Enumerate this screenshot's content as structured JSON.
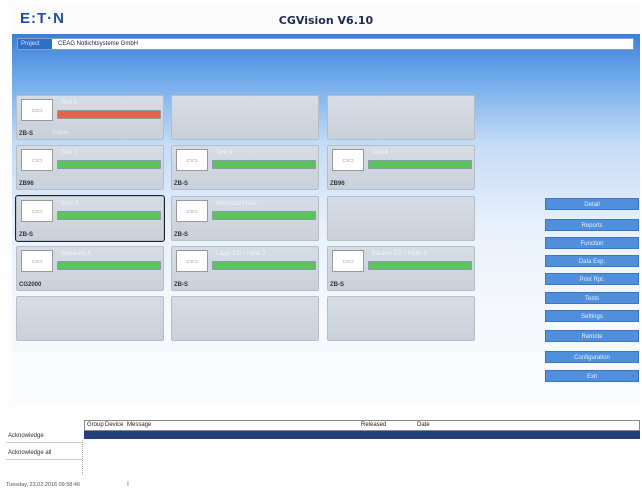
{
  "header": {
    "logo": "E:T·N",
    "title": "CGVision V6.10"
  },
  "project": {
    "label": "Project",
    "value": "CEAG Notlichtsysteme GmbH"
  },
  "colors": {
    "alarm": "#e36548",
    "ok": "#5cc45c",
    "accent": "#4f8fdc",
    "row_selected": "#23407a"
  },
  "tiles": [
    {
      "name": "Test 1",
      "code": "ZB-S",
      "status": "Failure",
      "state": "alarm"
    },
    {
      "name": "",
      "code": "",
      "status": "",
      "state": "empty"
    },
    {
      "name": "",
      "code": "",
      "status": "",
      "state": "empty"
    },
    {
      "name": "Test 2",
      "code": "ZB96",
      "status": "",
      "state": "ok"
    },
    {
      "name": "Test 3",
      "code": "ZB-S",
      "status": "",
      "state": "ok"
    },
    {
      "name": "Test 4",
      "code": "ZB96",
      "status": "",
      "state": "ok"
    },
    {
      "name": "Büro 5",
      "code": "ZB-S",
      "status": "",
      "state": "ok",
      "selected": true
    },
    {
      "name": "Werkstatt Halle",
      "code": "ZB-S",
      "status": "",
      "state": "ok"
    },
    {
      "name": "",
      "code": "",
      "status": "",
      "state": "empty"
    },
    {
      "name": "Gebäude 4",
      "code": "CG2000",
      "status": "",
      "state": "ok"
    },
    {
      "name": "Lager EG / Halle 2",
      "code": "ZB-S",
      "status": "",
      "state": "ok"
    },
    {
      "name": "Kantine EG / Halle 3",
      "code": "ZB-S",
      "status": "",
      "state": "ok"
    },
    {
      "name": "",
      "code": "",
      "status": "",
      "state": "empty"
    },
    {
      "name": "",
      "code": "",
      "status": "",
      "state": "empty"
    },
    {
      "name": "",
      "code": "",
      "status": "",
      "state": "empty"
    }
  ],
  "side_buttons": [
    "Detail",
    "Reports",
    "Function",
    "Data Exp.",
    "Print Rpt.",
    "Tests",
    "Settings",
    "Remote",
    "Configuration",
    "Exit"
  ],
  "messages": {
    "columns": [
      "Group",
      "Device",
      "Message",
      "Released",
      "Date"
    ]
  },
  "actions": {
    "acknowledge": "Acknowledge",
    "acknowledge_all": "Acknowledge all"
  },
  "status": {
    "datetime": "Tuesday, 23.02.2016 09:58:46",
    "cursor": "I"
  }
}
